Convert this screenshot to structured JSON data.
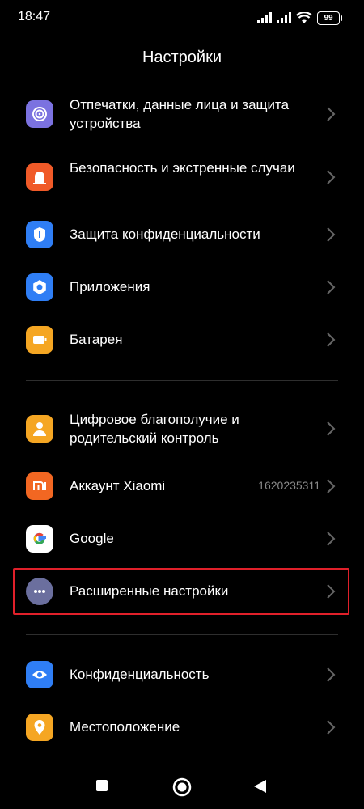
{
  "status_bar": {
    "time": "18:47",
    "battery": "99",
    "icons": [
      "signal-icon",
      "signal-icon",
      "wifi-icon",
      "battery-icon"
    ]
  },
  "header": {
    "title": "Настройки"
  },
  "groups": [
    {
      "items": [
        {
          "label": "Отпечатки, данные лица и защита устройства",
          "icon": "fingerprint-icon",
          "icon_color": "#7b72e0"
        },
        {
          "label": "Безопасность и экстренные случаи",
          "icon": "emergency-icon",
          "icon_color": "#f05a28"
        },
        {
          "label": "Защита конфиденциальности",
          "icon": "privacy-shield-icon",
          "icon_color": "#2f7ef5"
        },
        {
          "label": "Приложения",
          "icon": "apps-gear-icon",
          "icon_color": "#2f7ef5"
        },
        {
          "label": "Батарея",
          "icon": "battery-icon",
          "icon_color": "#f5a623"
        }
      ]
    },
    {
      "items": [
        {
          "label": "Цифровое благополучие и родительский контроль",
          "icon": "wellbeing-icon",
          "icon_color": "#f5a623"
        },
        {
          "label": "Аккаунт Xiaomi",
          "value": "1620235311",
          "icon": "xiaomi-mi-icon",
          "icon_color": "#f26722"
        },
        {
          "label": "Google",
          "icon": "google-icon",
          "icon_color": "#ffffff"
        },
        {
          "label": "Расширенные настройки",
          "icon": "more-dots-icon",
          "icon_color": "#6b6f9e"
        }
      ]
    },
    {
      "items": [
        {
          "label": "Конфиденциальность",
          "icon": "eye-icon",
          "icon_color": "#2f7ef5"
        },
        {
          "label": "Местоположение",
          "icon": "location-pin-icon",
          "icon_color": "#f5a623"
        }
      ]
    }
  ],
  "highlight_color": "#e0202a",
  "nav": {
    "buttons": [
      "recents-square-icon",
      "home-circle-icon",
      "back-triangle-icon"
    ]
  }
}
